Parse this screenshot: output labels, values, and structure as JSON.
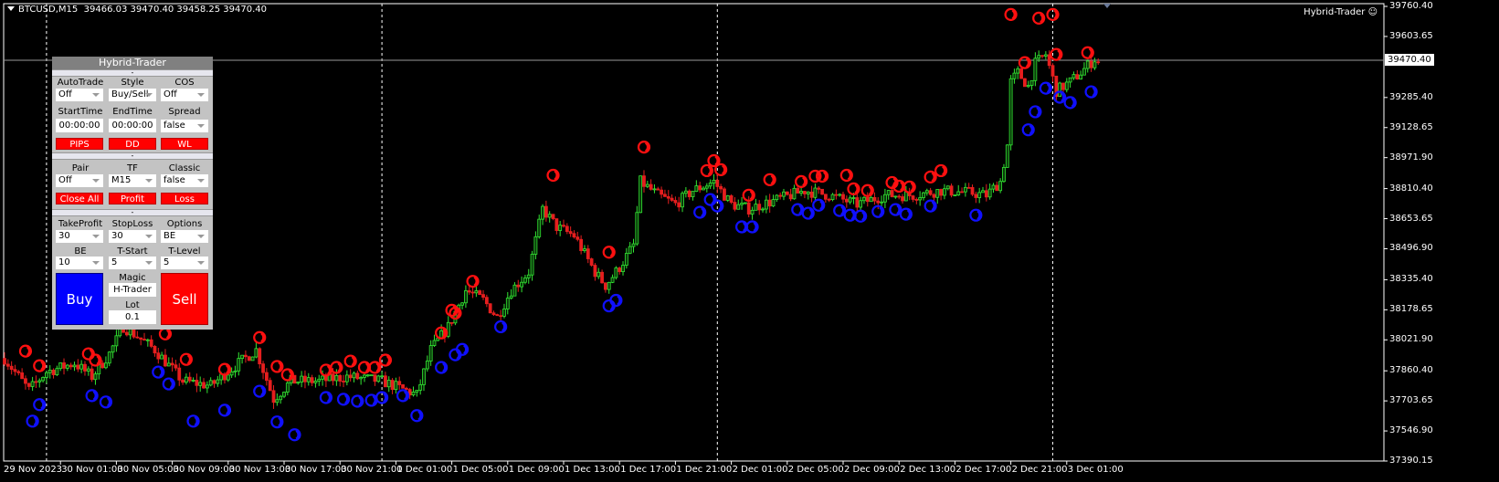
{
  "header": {
    "symbol": "BTCUSD,M15",
    "ohlc": "39466.03 39470.40 39458.25 39470.40"
  },
  "ea_label": "Hybrid-Trader",
  "ea_icon": "smiley-icon",
  "current_price": "39470.40",
  "price_axis": [
    "39760.40",
    "39603.65",
    "39285.40",
    "39128.65",
    "38971.90",
    "38810.40",
    "38653.65",
    "38496.90",
    "38335.40",
    "38178.65",
    "38021.90",
    "37860.40",
    "37703.65",
    "37546.90",
    "37390.15"
  ],
  "time_axis": [
    "29 Nov 2023",
    "30 Nov 01:00",
    "30 Nov 05:00",
    "30 Nov 09:00",
    "30 Nov 13:00",
    "30 Nov 17:00",
    "30 Nov 21:00",
    "1 Dec 01:00",
    "1 Dec 05:00",
    "1 Dec 09:00",
    "1 Dec 13:00",
    "1 Dec 17:00",
    "1 Dec 21:00",
    "2 Dec 01:00",
    "2 Dec 05:00",
    "2 Dec 09:00",
    "2 Dec 13:00",
    "2 Dec 17:00",
    "2 Dec 21:00",
    "3 Dec 01:00"
  ],
  "colors": {
    "background": "#000000",
    "bull": "#32e632",
    "bear": "#e61e1e",
    "sell_signal": "#ff1010",
    "buy_signal": "#1010ff",
    "buy_button": "#0000ff",
    "sell_button": "#ff0000"
  },
  "chart_data": {
    "type": "candlestick",
    "timeframe": "M15",
    "ylim": [
      37390.15,
      39760.4
    ],
    "close_path": [
      [
        "29 Nov 21:00",
        37925
      ],
      [
        "29 Nov 22:45",
        37760
      ],
      [
        "30 Nov 00:00",
        37855
      ],
      [
        "30 Nov 02:00",
        37900
      ],
      [
        "30 Nov 03:15",
        37830
      ],
      [
        "30 Nov 04:30",
        37950
      ],
      [
        "30 Nov 05:30",
        38090
      ],
      [
        "30 Nov 06:30",
        38040
      ],
      [
        "30 Nov 07:45",
        37970
      ],
      [
        "30 Nov 09:45",
        37807
      ],
      [
        "30 Nov 11:45",
        37783
      ],
      [
        "30 Nov 13:45",
        37900
      ],
      [
        "30 Nov 15:00",
        37970
      ],
      [
        "30 Nov 16:15",
        37712
      ],
      [
        "30 Nov 17:30",
        37807
      ],
      [
        "30 Nov 19:30",
        37807
      ],
      [
        "30 Nov 21:30",
        37830
      ],
      [
        "1 Dec 00:00",
        37807
      ],
      [
        "1 Dec 02:30",
        37735
      ],
      [
        "1 Dec 03:30",
        37970
      ],
      [
        "1 Dec 04:45",
        38090
      ],
      [
        "1 Dec 06:00",
        38280
      ],
      [
        "1 Dec 07:15",
        38230
      ],
      [
        "1 Dec 08:15",
        38140
      ],
      [
        "1 Dec 09:15",
        38280
      ],
      [
        "1 Dec 10:30",
        38375
      ],
      [
        "1 Dec 11:30",
        38705
      ],
      [
        "1 Dec 12:30",
        38610
      ],
      [
        "1 Dec 13:45",
        38565
      ],
      [
        "1 Dec 15:15",
        38375
      ],
      [
        "1 Dec 16:00",
        38305
      ],
      [
        "1 Dec 17:00",
        38400
      ],
      [
        "1 Dec 18:00",
        38515
      ],
      [
        "1 Dec 18:30",
        38847
      ],
      [
        "1 Dec 19:45",
        38776
      ],
      [
        "1 Dec 21:00",
        38729
      ],
      [
        "1 Dec 22:15",
        38800
      ],
      [
        "1 Dec 23:45",
        38847
      ],
      [
        "2 Dec 01:00",
        38729
      ],
      [
        "2 Dec 02:15",
        38705
      ],
      [
        "2 Dec 04:15",
        38752
      ],
      [
        "2 Dec 06:15",
        38800
      ],
      [
        "2 Dec 08:00",
        38776
      ],
      [
        "2 Dec 10:00",
        38729
      ],
      [
        "2 Dec 12:00",
        38776
      ],
      [
        "2 Dec 14:00",
        38776
      ],
      [
        "2 Dec 16:00",
        38800
      ],
      [
        "2 Dec 18:00",
        38790
      ],
      [
        "2 Dec 19:15",
        38776
      ],
      [
        "2 Dec 20:15",
        38847
      ],
      [
        "2 Dec 20:45",
        39036
      ],
      [
        "2 Dec 21:00",
        39367
      ],
      [
        "2 Dec 21:30",
        39415
      ],
      [
        "2 Dec 22:15",
        39344
      ],
      [
        "2 Dec 22:45",
        39462
      ],
      [
        "2 Dec 23:30",
        39510
      ],
      [
        "3 Dec 00:15",
        39320
      ],
      [
        "3 Dec 01:15",
        39367
      ],
      [
        "3 Dec 02:00",
        39415
      ],
      [
        "3 Dec 03:00",
        39486
      ],
      [
        "3 Dec 03:15",
        39470.4
      ]
    ],
    "day_separators": [
      "30 Nov 00:00",
      "1 Dec 00:00",
      "2 Dec 00:00",
      "3 Dec 00:00"
    ],
    "sell_signals": [
      [
        "29 Nov 22:30",
        37963
      ],
      [
        "29 Nov 23:30",
        37887
      ],
      [
        "30 Nov 03:00",
        37949
      ],
      [
        "30 Nov 03:30",
        37916
      ],
      [
        "30 Nov 06:15",
        38114
      ],
      [
        "30 Nov 08:30",
        38053
      ],
      [
        "30 Nov 10:00",
        37920
      ],
      [
        "30 Nov 12:45",
        37868
      ],
      [
        "30 Nov 15:15",
        38034
      ],
      [
        "30 Nov 16:30",
        37883
      ],
      [
        "30 Nov 17:15",
        37840
      ],
      [
        "30 Nov 20:00",
        37864
      ],
      [
        "30 Nov 20:45",
        37878
      ],
      [
        "30 Nov 21:45",
        37911
      ],
      [
        "30 Nov 22:45",
        37878
      ],
      [
        "30 Nov 23:30",
        37878
      ],
      [
        "1 Dec 00:15",
        37916
      ],
      [
        "1 Dec 04:15",
        38058
      ],
      [
        "1 Dec 05:00",
        38176
      ],
      [
        "1 Dec 05:15",
        38161
      ],
      [
        "1 Dec 06:30",
        38327
      ],
      [
        "1 Dec 12:15",
        38880
      ],
      [
        "1 Dec 16:15",
        38479
      ],
      [
        "1 Dec 18:45",
        39027
      ],
      [
        "1 Dec 23:15",
        38904
      ],
      [
        "1 Dec 23:45",
        38956
      ],
      [
        "2 Dec 00:15",
        38909
      ],
      [
        "2 Dec 02:15",
        38776
      ],
      [
        "2 Dec 03:45",
        38857
      ],
      [
        "2 Dec 06:00",
        38847
      ],
      [
        "2 Dec 07:00",
        38875
      ],
      [
        "2 Dec 07:30",
        38875
      ],
      [
        "2 Dec 09:15",
        38880
      ],
      [
        "2 Dec 09:45",
        38809
      ],
      [
        "2 Dec 10:45",
        38800
      ],
      [
        "2 Dec 12:30",
        38842
      ],
      [
        "2 Dec 13:00",
        38823
      ],
      [
        "2 Dec 13:45",
        38819
      ],
      [
        "2 Dec 15:15",
        38871
      ],
      [
        "2 Dec 16:00",
        38904
      ],
      [
        "2 Dec 21:00",
        39718
      ],
      [
        "2 Dec 22:00",
        39467
      ],
      [
        "2 Dec 23:00",
        39699
      ],
      [
        "3 Dec 00:00",
        39718
      ],
      [
        "3 Dec 00:15",
        39510
      ],
      [
        "3 Dec 02:30",
        39519
      ]
    ],
    "buy_signals": [
      [
        "29 Nov 23:00",
        37598
      ],
      [
        "29 Nov 23:30",
        37684
      ],
      [
        "30 Nov 03:15",
        37731
      ],
      [
        "30 Nov 04:15",
        37698
      ],
      [
        "30 Nov 08:00",
        37854
      ],
      [
        "30 Nov 08:45",
        37792
      ],
      [
        "30 Nov 10:30",
        37598
      ],
      [
        "30 Nov 12:45",
        37655
      ],
      [
        "30 Nov 15:15",
        37754
      ],
      [
        "30 Nov 16:30",
        37594
      ],
      [
        "30 Nov 17:45",
        37527
      ],
      [
        "30 Nov 20:00",
        37721
      ],
      [
        "30 Nov 21:15",
        37712
      ],
      [
        "30 Nov 22:15",
        37702
      ],
      [
        "30 Nov 23:15",
        37707
      ],
      [
        "1 Dec 00:00",
        37721
      ],
      [
        "1 Dec 01:30",
        37731
      ],
      [
        "1 Dec 02:30",
        37627
      ],
      [
        "1 Dec 04:15",
        37878
      ],
      [
        "1 Dec 05:15",
        37944
      ],
      [
        "1 Dec 05:45",
        37972
      ],
      [
        "1 Dec 08:30",
        38090
      ],
      [
        "1 Dec 16:15",
        38199
      ],
      [
        "1 Dec 16:45",
        38228
      ],
      [
        "1 Dec 22:45",
        38687
      ],
      [
        "1 Dec 23:30",
        38753
      ],
      [
        "2 Dec 00:00",
        38720
      ],
      [
        "2 Dec 01:45",
        38611
      ],
      [
        "2 Dec 02:30",
        38611
      ],
      [
        "2 Dec 05:45",
        38701
      ],
      [
        "2 Dec 06:30",
        38682
      ],
      [
        "2 Dec 07:15",
        38724
      ],
      [
        "2 Dec 08:45",
        38696
      ],
      [
        "2 Dec 09:30",
        38672
      ],
      [
        "2 Dec 10:15",
        38667
      ],
      [
        "2 Dec 11:30",
        38691
      ],
      [
        "2 Dec 12:45",
        38701
      ],
      [
        "2 Dec 13:30",
        38677
      ],
      [
        "2 Dec 15:15",
        38720
      ],
      [
        "2 Dec 18:30",
        38672
      ],
      [
        "2 Dec 22:15",
        39117
      ],
      [
        "2 Dec 22:45",
        39211
      ],
      [
        "2 Dec 23:30",
        39334
      ],
      [
        "3 Dec 00:30",
        39287
      ],
      [
        "3 Dec 01:15",
        39259
      ],
      [
        "3 Dec 02:45",
        39315
      ]
    ]
  },
  "panel": {
    "title": "Hybrid-Trader",
    "collapse": "-",
    "s1": {
      "autotrade_label": "AutoTrade",
      "autotrade": "Off",
      "style_label": "Style",
      "style": "Buy/Sell",
      "cos_label": "COS",
      "cos": "Off",
      "start_label": "StartTime",
      "start": "00:00:00",
      "end_label": "EndTime",
      "end": "00:00:00",
      "spread_label": "Spread",
      "spread": "false",
      "pips": "PIPS",
      "dd": "DD",
      "wl": "WL"
    },
    "s2": {
      "pair_label": "Pair",
      "pair": "Off",
      "tf_label": "TF",
      "tf": "M15",
      "classic_label": "Classic",
      "classic": "false",
      "close_all": "Close All",
      "profit": "Profit",
      "loss": "Loss"
    },
    "s3": {
      "tp_label": "TakeProfit",
      "tp": "30",
      "sl_label": "StopLoss",
      "sl": "30",
      "options_label": "Options",
      "options": "BE",
      "be_label": "BE",
      "be": "10",
      "tstart_label": "T-Start",
      "tstart": "5",
      "tlevel_label": "T-Level",
      "tlevel": "5",
      "buy": "Buy",
      "sell": "Sell",
      "magic_label": "Magic",
      "magic": "H-Trader",
      "lot_label": "Lot",
      "lot": "0.1"
    }
  }
}
